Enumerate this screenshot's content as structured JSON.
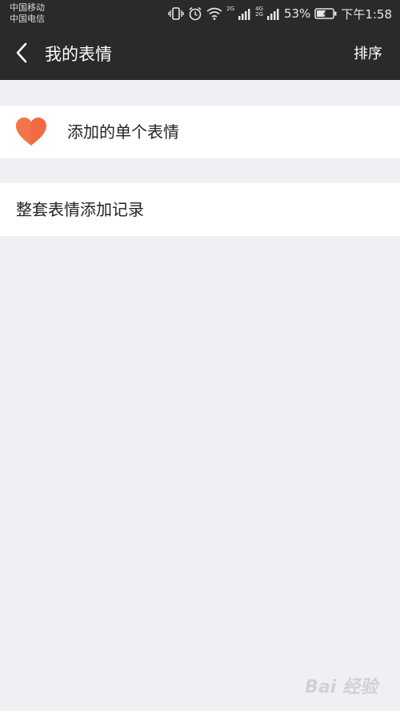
{
  "status_bar": {
    "carrier_1": "中国移动",
    "carrier_2": "中国电信",
    "net_1": "2G",
    "net_2_top": "4G",
    "net_2_bottom": "2G",
    "battery": "53%",
    "time": "下午1:58",
    "icons": [
      "vibrate-icon",
      "alarm-icon",
      "wifi-icon",
      "signal-icon",
      "battery-icon"
    ]
  },
  "header": {
    "title": "我的表情",
    "sort_label": "排序",
    "back_icon": "chevron-left-icon"
  },
  "list": {
    "single_emoji": {
      "label": "添加的单个表情",
      "icon": "heart-icon",
      "icon_color": "#f26a43"
    },
    "emoji_sets": {
      "label": "整套表情添加记录"
    }
  },
  "watermark": {
    "text": "Bai 经验"
  },
  "colors": {
    "bar_background": "#2a2a2a",
    "page_background": "#efeff4",
    "item_background": "#ffffff"
  }
}
